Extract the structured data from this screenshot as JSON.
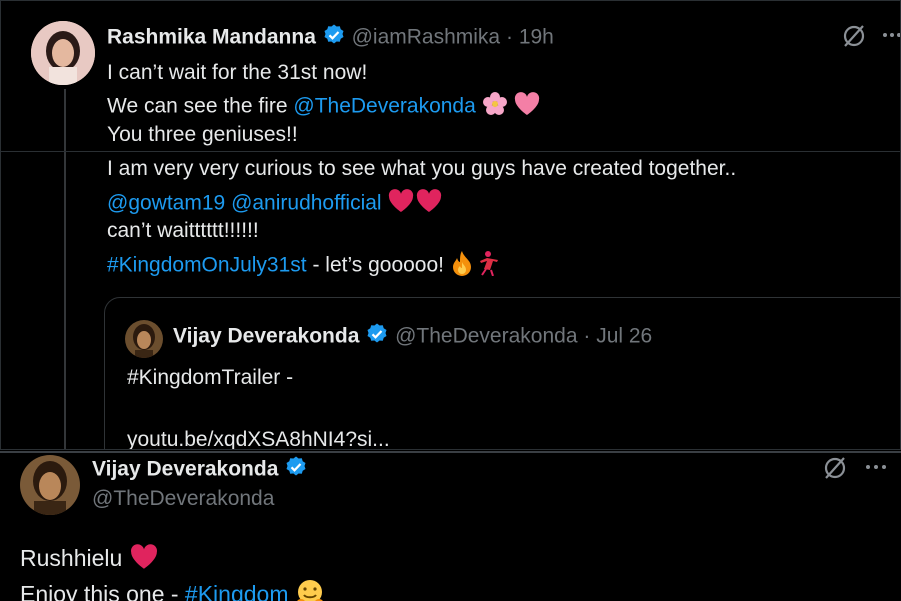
{
  "tweet1": {
    "name": "Rashmika Mandanna",
    "handle": "@iamRashmika",
    "sep": "·",
    "time": "19h",
    "line1": "I can’t wait for the 31st now!",
    "line2_pre": "We can see the fire ",
    "line2_mention": "@TheDeverakonda",
    "line3": "You three geniuses!!",
    "line4": "I am very very curious to see what you guys have created together..",
    "line5_m1": "@gowtam19",
    "line5_m2": "@anirudhofficial",
    "line6": "can’t waitttttt!!!!!!",
    "line7_tag": "#KingdomOnJuly31st",
    "line7_rest": " - let’s gooooo!"
  },
  "quote": {
    "name": "Vijay Deverakonda",
    "handle": "@TheDeverakonda",
    "sep": "·",
    "date": "Jul 26",
    "line1": "#KingdomTrailer -",
    "line2": "youtu.be/xqdXSA8hNI4?si..."
  },
  "tweet2": {
    "name": "Vijay Deverakonda",
    "handle": "@TheDeverakonda",
    "line1": "Rushhielu",
    "line2_pre": "Enjoy this one - ",
    "line2_tag": "#Kingdom"
  },
  "icons": {
    "verified": "verified-badge-icon",
    "grok": "grok-icon",
    "more": "more-icon"
  },
  "colors": {
    "link": "#1d9bf0",
    "verified": "#1d9bf0",
    "heart": "#f91880"
  }
}
